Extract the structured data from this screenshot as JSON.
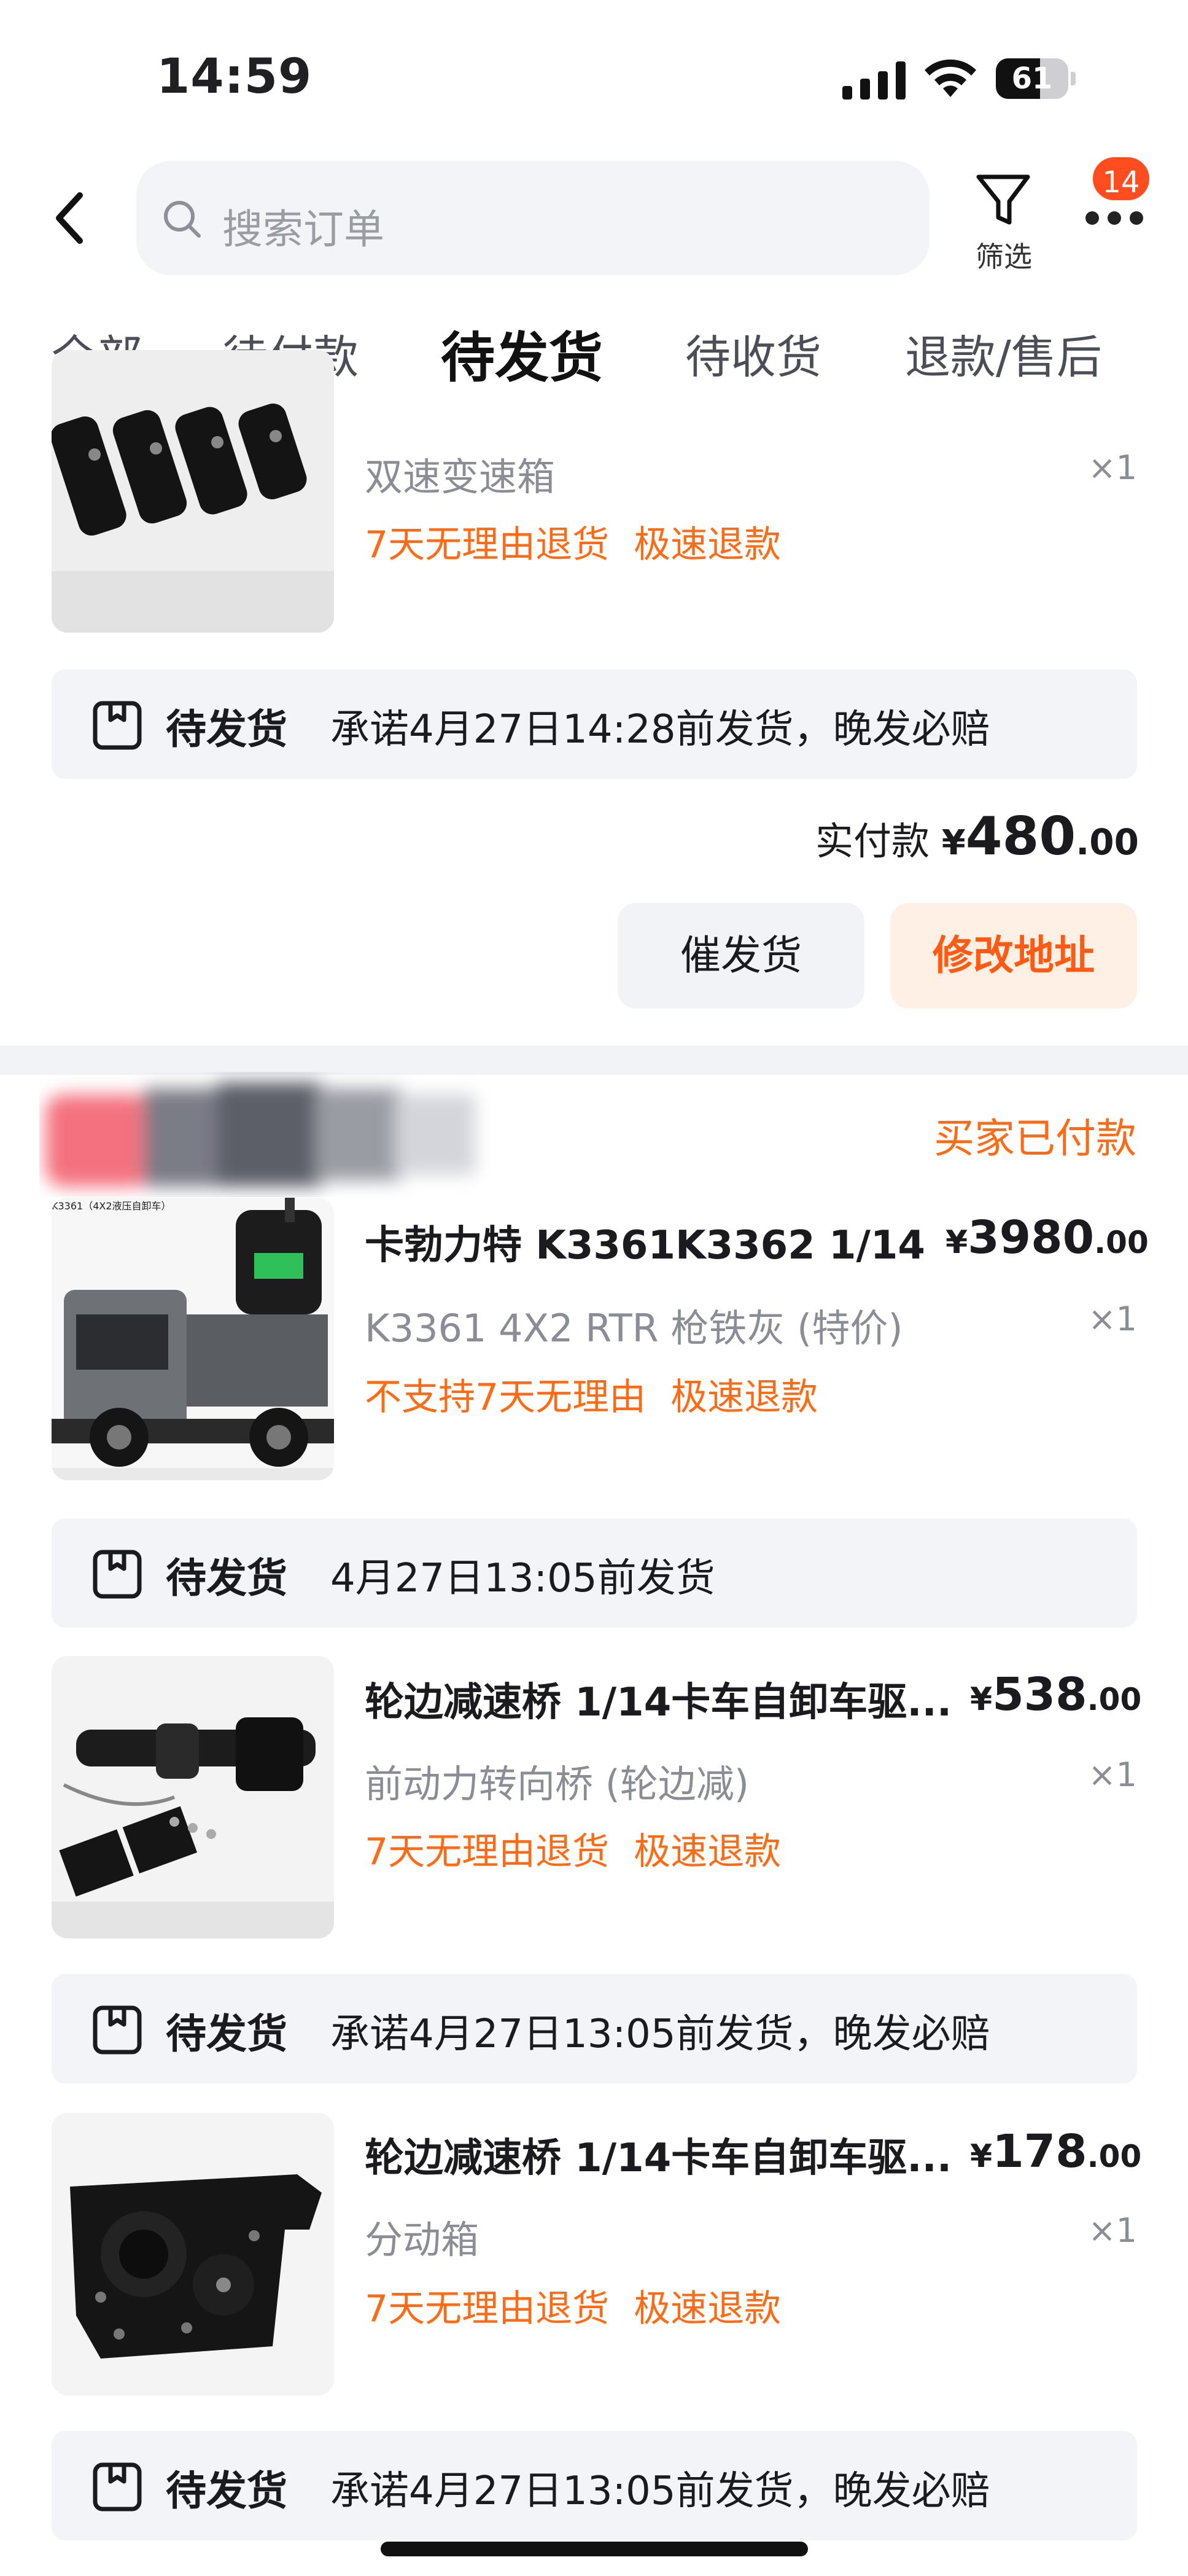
{
  "status_bar": {
    "time": "14:59",
    "battery": "61",
    "battery_level": 0.61
  },
  "header": {
    "search_placeholder": "搜索订单",
    "filter_label": "筛选",
    "badge_count": "14"
  },
  "tabs": [
    {
      "label": "全部",
      "active": false
    },
    {
      "label": "待付款",
      "active": false
    },
    {
      "label": "待发货",
      "active": true
    },
    {
      "label": "待收货",
      "active": false
    },
    {
      "label": "退款/售后",
      "active": false
    }
  ],
  "order1": {
    "item": {
      "spec": "双速变速箱",
      "qty": "×1",
      "tags": [
        "7天无理由退货",
        "极速退款"
      ]
    },
    "shipping": {
      "status": "待发货",
      "message": "承诺4月27日14:28前发货，晚发必赔"
    },
    "total": {
      "label": "实付款",
      "currency": "¥",
      "int": "480",
      "dec": ".00"
    },
    "buttons": {
      "remind": "催发货",
      "modify": "修改地址"
    }
  },
  "order2": {
    "status": "买家已付款",
    "items": [
      {
        "name": "卡勃力特 K3361K3362 1/14 ...",
        "currency": "¥",
        "price_int": "3980",
        "price_dec": ".00",
        "spec": "K3361 4X2 RTR 枪铁灰 (特价)",
        "qty": "×1",
        "tags": [
          "不支持7天无理由",
          "极速退款"
        ],
        "thumb_caption": "K3361（4X2液压自卸车）",
        "shipping": {
          "status": "待发货",
          "message": "4月27日13:05前发货"
        }
      },
      {
        "name": "轮边减速桥 1/14卡车自卸车驱...",
        "currency": "¥",
        "price_int": "538",
        "price_dec": ".00",
        "spec": "前动力转向桥 (轮边减)",
        "qty": "×1",
        "tags": [
          "7天无理由退货",
          "极速退款"
        ],
        "shipping": {
          "status": "待发货",
          "message": "承诺4月27日13:05前发货，晚发必赔"
        }
      },
      {
        "name": "轮边减速桥 1/14卡车自卸车驱...",
        "currency": "¥",
        "price_int": "178",
        "price_dec": ".00",
        "spec": "分动箱",
        "qty": "×1",
        "tags": [
          "7天无理由退货",
          "极速退款"
        ],
        "shipping": {
          "status": "待发货",
          "message": "承诺4月27日13:05前发货，晚发必赔"
        }
      }
    ]
  },
  "colors": {
    "accent": "#ff6a14",
    "badge": "#ff4d1f",
    "ship_bg": "#f2f4f8",
    "divider": "#f2f3f7"
  }
}
